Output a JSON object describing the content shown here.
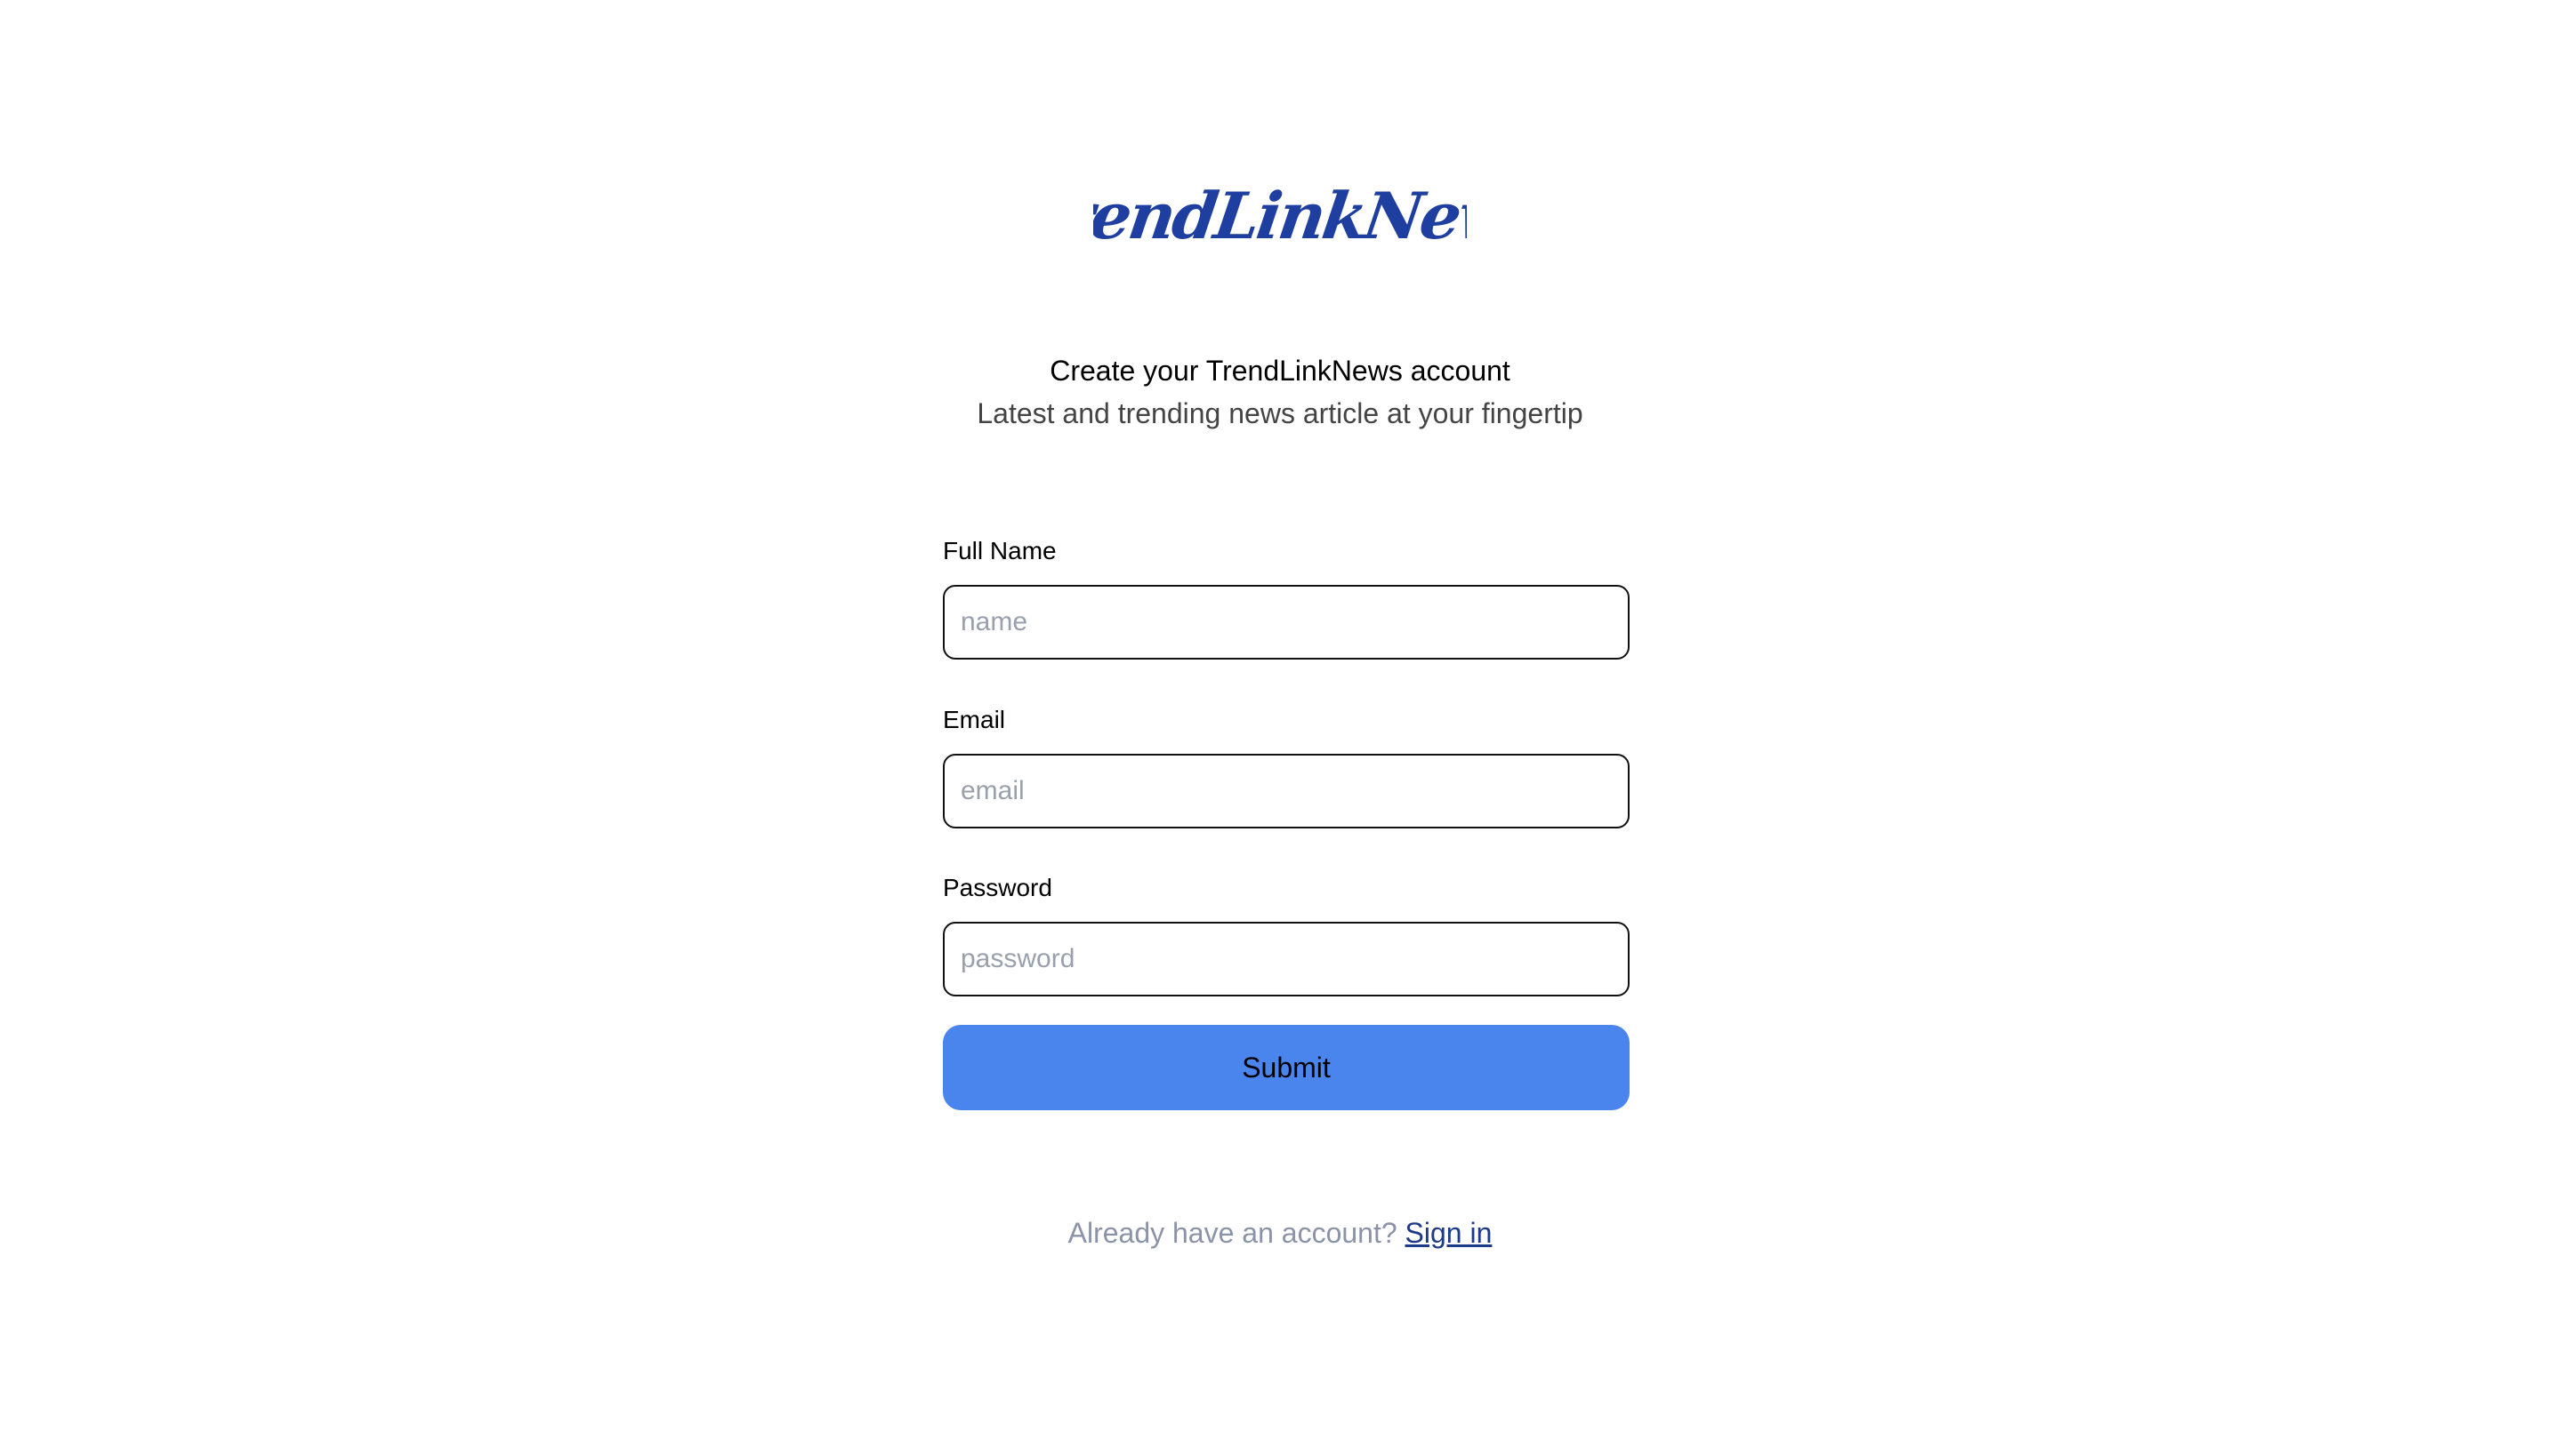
{
  "brand": {
    "logo_text": "TrendLinkNews",
    "logo_color": "#1e3ea0"
  },
  "intro": {
    "heading": "Create your TrendLinkNews account",
    "subheading": "Latest and trending news article at your fingertip"
  },
  "form": {
    "full_name": {
      "label": "Full Name",
      "placeholder": "name",
      "value": ""
    },
    "email": {
      "label": "Email",
      "placeholder": "email",
      "value": ""
    },
    "password": {
      "label": "Password",
      "placeholder": "password",
      "value": ""
    },
    "submit_label": "Submit",
    "submit_color": "#4a85ee"
  },
  "footer": {
    "prompt": "Already have an account?",
    "signin_label": "Sign in",
    "link_color": "#1e3a8a"
  }
}
